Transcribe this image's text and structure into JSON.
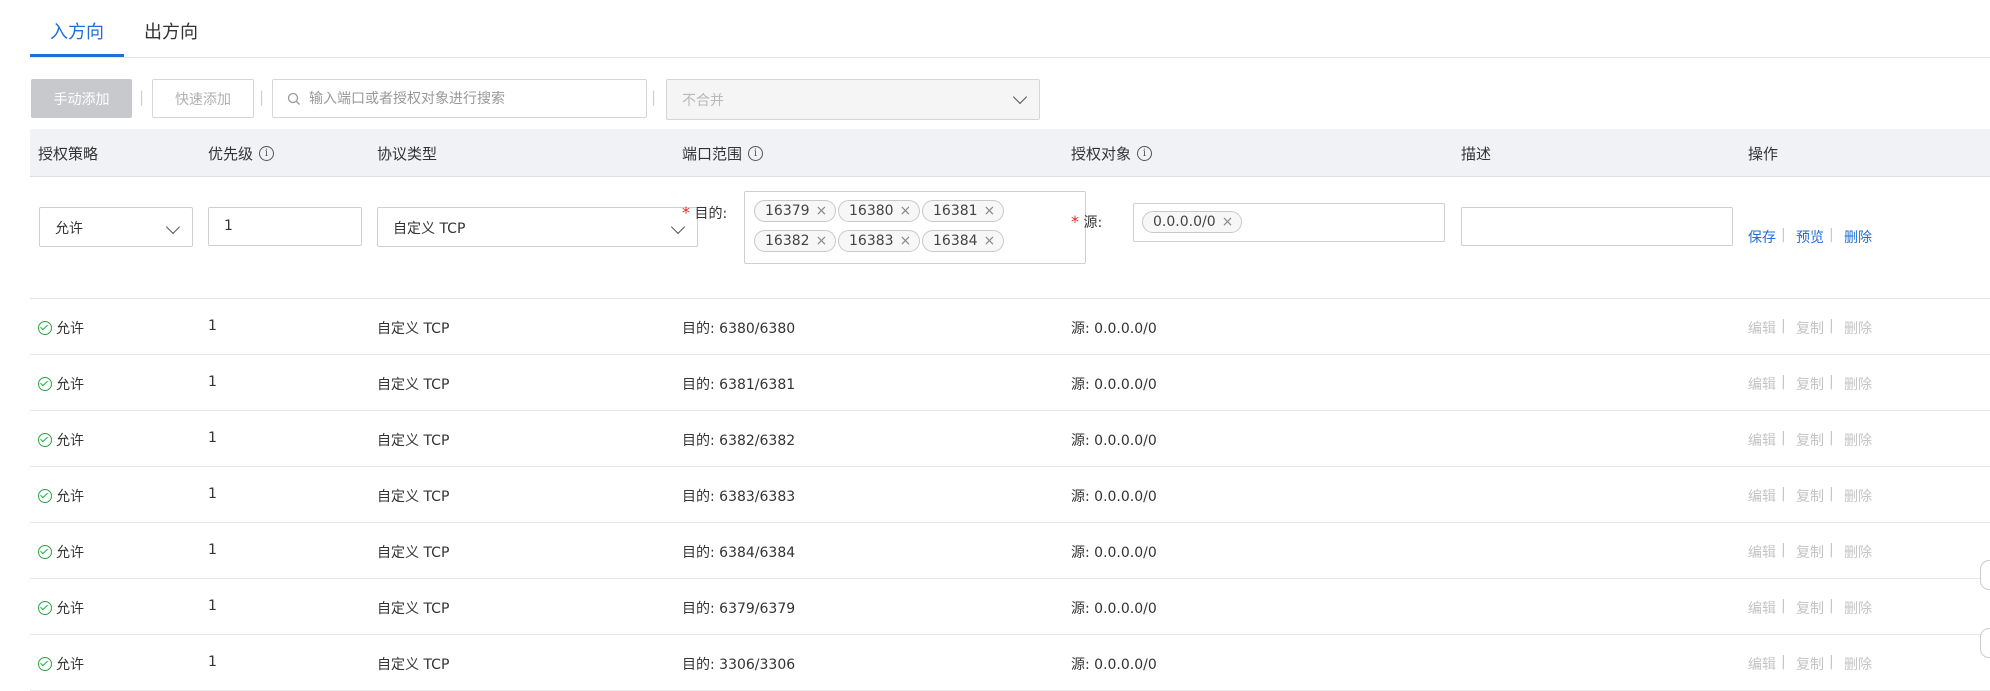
{
  "tabs": [
    {
      "label": "入方向",
      "active": true
    },
    {
      "label": "出方向",
      "active": false
    }
  ],
  "toolbar": {
    "manual_add": "手动添加",
    "quick_add": "快速添加",
    "separator": "|",
    "search_placeholder": "输入端口或者授权对象进行搜索",
    "merge_select": "不合并"
  },
  "columns": {
    "policy": "授权策略",
    "priority": "优先级",
    "protocol": "协议类型",
    "port_range": "端口范围",
    "auth_object": "授权对象",
    "description": "描述",
    "actions": "操作"
  },
  "info_glyph": "i",
  "edit_row": {
    "policy": "允许",
    "priority": "1",
    "protocol": "自定义 TCP",
    "required_mark": "*",
    "dest_label": "目的:",
    "dest_ports": [
      "16379",
      "16380",
      "16381",
      "16382",
      "16383",
      "16384"
    ],
    "src_label": "源:",
    "src_values": [
      "0.0.0.0/0"
    ],
    "description": "",
    "remove_glyph": "×",
    "actions": {
      "save": "保存",
      "preview": "预览",
      "delete": "删除"
    }
  },
  "rows": [
    {
      "policy": "允许",
      "priority": "1",
      "protocol": "自定义 TCP",
      "port": "目的: 6380/6380",
      "source": "源: 0.0.0.0/0"
    },
    {
      "policy": "允许",
      "priority": "1",
      "protocol": "自定义 TCP",
      "port": "目的: 6381/6381",
      "source": "源: 0.0.0.0/0"
    },
    {
      "policy": "允许",
      "priority": "1",
      "protocol": "自定义 TCP",
      "port": "目的: 6382/6382",
      "source": "源: 0.0.0.0/0"
    },
    {
      "policy": "允许",
      "priority": "1",
      "protocol": "自定义 TCP",
      "port": "目的: 6383/6383",
      "source": "源: 0.0.0.0/0"
    },
    {
      "policy": "允许",
      "priority": "1",
      "protocol": "自定义 TCP",
      "port": "目的: 6384/6384",
      "source": "源: 0.0.0.0/0"
    },
    {
      "policy": "允许",
      "priority": "1",
      "protocol": "自定义 TCP",
      "port": "目的: 6379/6379",
      "source": "源: 0.0.0.0/0"
    },
    {
      "policy": "允许",
      "priority": "1",
      "protocol": "自定义 TCP",
      "port": "目的: 3306/3306",
      "source": "源: 0.0.0.0/0"
    }
  ],
  "row_actions": {
    "edit": "编辑",
    "copy": "复制",
    "delete": "删除"
  },
  "colors": {
    "accent": "#1e6fd9",
    "success": "#27a844",
    "required": "#e0291e",
    "disabled_text": "#c4c4c4"
  }
}
